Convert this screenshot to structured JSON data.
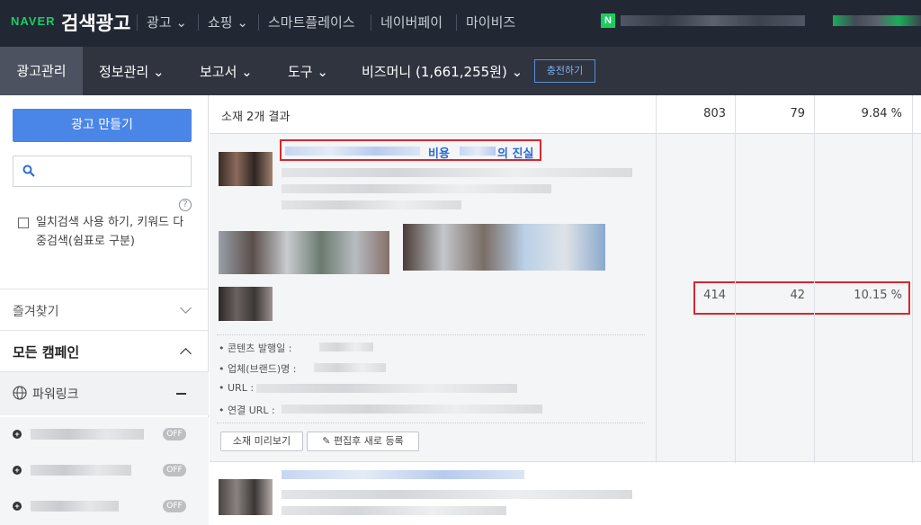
{
  "topbar": {
    "naver": "NAVER",
    "title": "검색광고",
    "nav": [
      "광고",
      "쇼핑",
      "스마트플레이스",
      "네이버페이",
      "마이비즈"
    ],
    "n_badge": "N"
  },
  "subnav": {
    "items": [
      "광고관리",
      "정보관리",
      "보고서",
      "도구",
      "비즈머니 (1,661,255원)"
    ],
    "charge": "충전하기"
  },
  "sidebar": {
    "create": "광고 만들기",
    "help": "?",
    "checkbox_label": "일치검색 사용 하기, 키워드 다중검색(쉼표로 구분)",
    "favorites": "즐겨찾기",
    "all_campaigns": "모든 캠페인",
    "powerlink": "파워링크",
    "off": "OFF",
    "plus": "+"
  },
  "table": {
    "result": "소재 2개 결과",
    "totals": [
      "803",
      "79",
      "9.84 %"
    ],
    "item1": {
      "title_word1": "비용",
      "title_word2": "의 진실",
      "row": [
        "414",
        "42",
        "10.15 %"
      ],
      "info": [
        "콘텐츠 발행일 :",
        "업체(브랜드)명 :",
        "URL :",
        "연결 URL :"
      ],
      "preview": "소재 미리보기",
      "edit": "편집후 새로 등록"
    }
  },
  "colors": {
    "accent": "#4a86e8",
    "naver_green": "#19ce60",
    "highlight": "#d9262e"
  }
}
